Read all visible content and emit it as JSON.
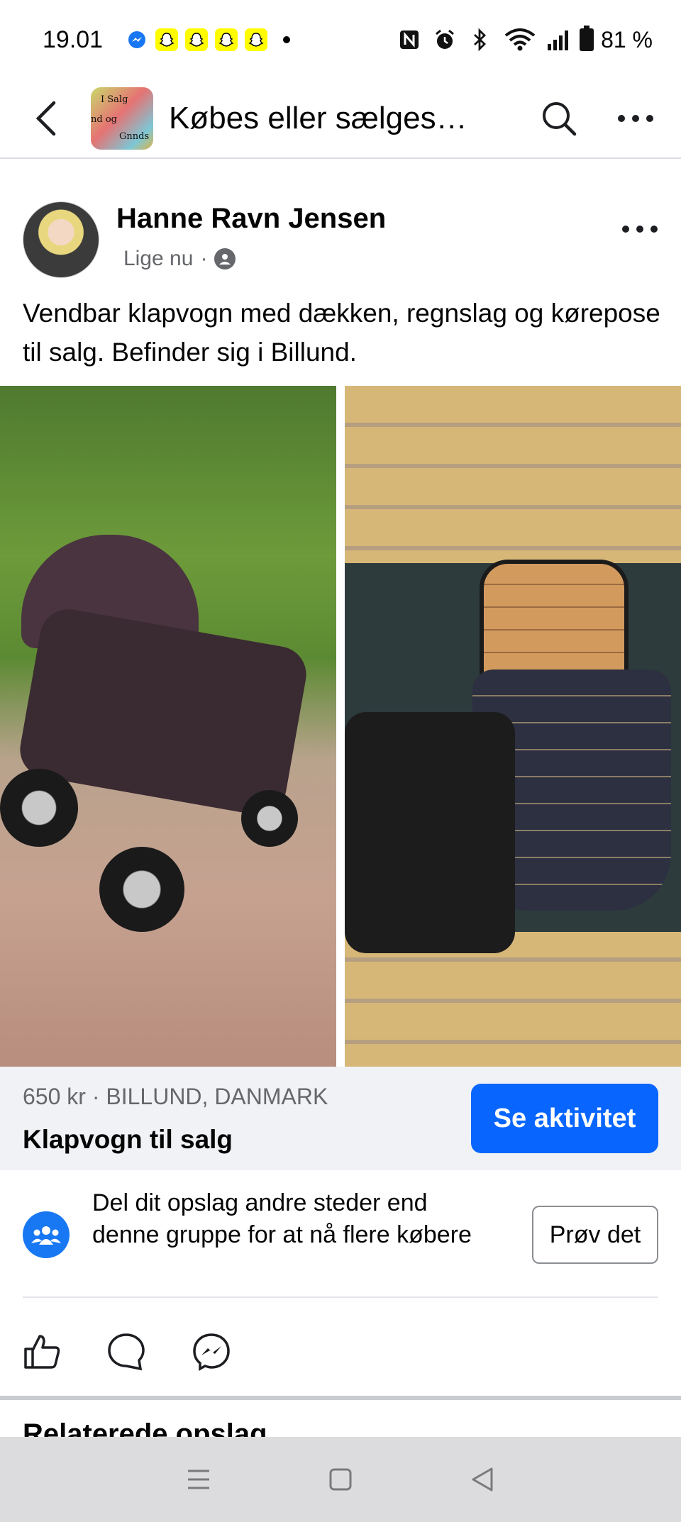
{
  "status_bar": {
    "time": "19.01",
    "battery": "81 %",
    "notifications": [
      "messenger-icon",
      "snapchat-icon",
      "snapchat-icon",
      "snapchat-icon",
      "snapchat-icon"
    ],
    "system_icons": [
      "nfc-icon",
      "alarm-icon",
      "bluetooth-icon",
      "wifi-icon",
      "signal-icon",
      "battery-icon"
    ]
  },
  "nav": {
    "title": "Købes eller sælges…",
    "group_thumb_text": [
      "I Salg",
      "nd og",
      "Gnnds"
    ]
  },
  "post": {
    "author": "Hanne Ravn Jensen",
    "time": "Lige nu",
    "separator": "·",
    "text": "Vendbar klapvogn med dækken, regnslag og kørepose til salg. Befinder sig i Billund.",
    "photos": [
      {
        "alt": "stroller-photo"
      },
      {
        "alt": "sleeping-bag-photo"
      }
    ]
  },
  "listing": {
    "meta": "650 kr · BILLUND, DANMARK",
    "title": "Klapvogn til salg",
    "button": "Se aktivitet"
  },
  "promo": {
    "text": "Del dit opslag andre steder end denne gruppe for at nå flere købere",
    "button": "Prøv det"
  },
  "next_section_title": "Relaterede opslag",
  "colors": {
    "primary": "#0866ff",
    "listing_bg": "#f0f2f5",
    "secondary_text": "#65676b"
  }
}
